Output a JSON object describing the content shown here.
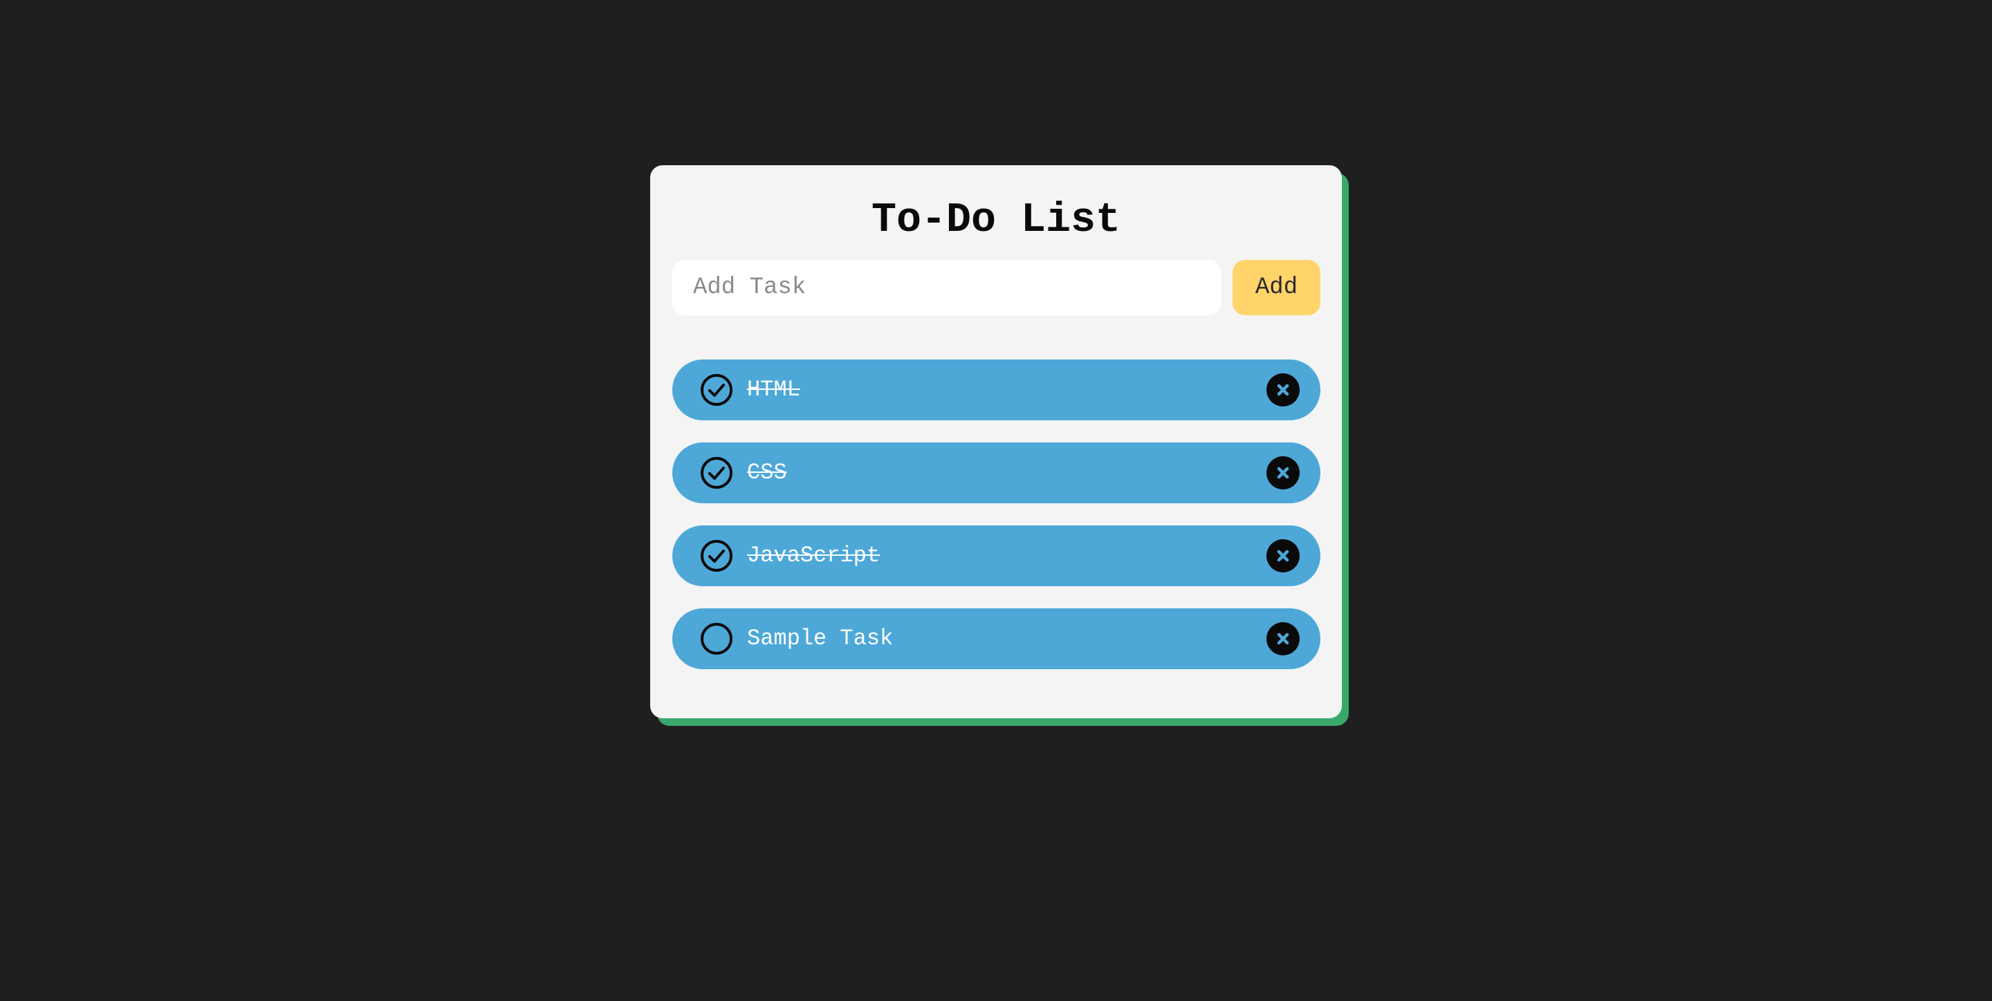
{
  "app": {
    "title": "To-Do List"
  },
  "input": {
    "placeholder": "Add Task",
    "value": ""
  },
  "add_button": {
    "label": "Add"
  },
  "tasks": [
    {
      "label": "HTML",
      "completed": true
    },
    {
      "label": "CSS",
      "completed": true
    },
    {
      "label": "JavaScript",
      "completed": true
    },
    {
      "label": "Sample Task",
      "completed": false
    }
  ],
  "icons": {
    "check": "circle-check-icon",
    "unchecked": "circle-icon",
    "delete": "circle-x-icon"
  },
  "colors": {
    "background": "#1f1f1f",
    "card": "#f4f4f4",
    "card_shadow": "#3aa86b",
    "task_item": "#4da8d8",
    "add_button": "#ffd46b",
    "icon_dark": "#0a0a0a"
  }
}
